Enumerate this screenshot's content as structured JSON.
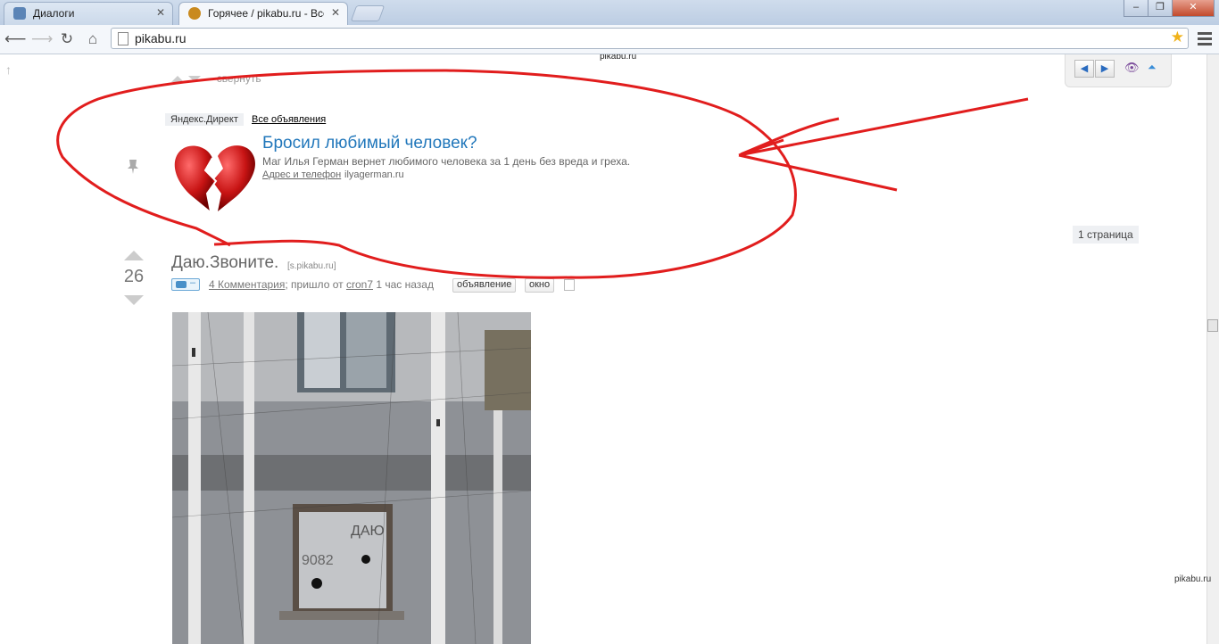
{
  "browser": {
    "tabs": [
      {
        "label": "Диалоги",
        "active": false,
        "favicon": "vk-message-icon"
      },
      {
        "label": "Горячее / pikabu.ru - Все",
        "active": true,
        "favicon": "pikabu-icon"
      }
    ],
    "window_controls": {
      "minimize": "–",
      "restore": "❐",
      "close": "✕"
    },
    "url": "pikabu.ru",
    "accent_close": "#c24a2c"
  },
  "page": {
    "site_label": "pikabu.ru",
    "collapse_label": "свернуть",
    "ad": {
      "tag": "Яндекс.Директ",
      "all_ads": "Все объявления",
      "title": "Бросил любимый человек?",
      "text": "Маг Илья Герман вернет любимого человека за 1 день без вреда и греха.",
      "contact": "Адрес и телефон",
      "domain": "ilyagerman.ru"
    },
    "page_count": "1 страница",
    "post": {
      "score": "26",
      "title": "Даю.Звоните.",
      "domain": "[s.pikabu.ru]",
      "photo_badge": "–",
      "comments": "4 Комментария",
      "from_text": "; пришло от",
      "author": "cron7",
      "time": "1 час назад",
      "buttons": [
        "объявление",
        "окно"
      ]
    },
    "watermark": "pikabu.ru"
  },
  "colors": {
    "annotation": "#e11d1d",
    "link": "#2177bb"
  }
}
